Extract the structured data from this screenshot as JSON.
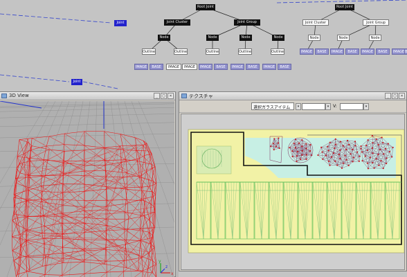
{
  "node_graph": {
    "nodes": [
      {
        "id": "n_left_sel",
        "label": "Joint",
        "style": "sel"
      },
      {
        "id": "n_root1",
        "label": "Root Joint",
        "style": "black"
      },
      {
        "id": "n_root2",
        "label": "Root Joint",
        "style": "black"
      },
      {
        "id": "n_a1",
        "label": "Joint Cluster",
        "style": "black"
      },
      {
        "id": "n_a2",
        "label": "Joint Group",
        "style": "black"
      },
      {
        "id": "n_b1",
        "label": "Joint Cluster",
        "style": "white"
      },
      {
        "id": "n_b2",
        "label": "Joint Group",
        "style": "white"
      },
      {
        "id": "n_c1",
        "label": "Node",
        "style": "black"
      },
      {
        "id": "n_c2",
        "label": "Node",
        "style": "black"
      },
      {
        "id": "n_c3",
        "label": "Node",
        "style": "black"
      },
      {
        "id": "n_c4",
        "label": "Node",
        "style": "black"
      },
      {
        "id": "n_d1",
        "label": "Node",
        "style": "white"
      },
      {
        "id": "n_d2",
        "label": "Node",
        "style": "white"
      },
      {
        "id": "n_d3",
        "label": "Node",
        "style": "white"
      },
      {
        "id": "n_e1",
        "label": "Outline",
        "style": "white"
      },
      {
        "id": "n_e2",
        "label": "Outline",
        "style": "white"
      },
      {
        "id": "n_e3",
        "label": "Outline",
        "style": "white"
      },
      {
        "id": "n_e4",
        "label": "Outline",
        "style": "white"
      },
      {
        "id": "n_e5",
        "label": "Outline",
        "style": "white"
      },
      {
        "id": "n_f1",
        "label": "IMAGE",
        "style": "blue"
      },
      {
        "id": "n_f2",
        "label": "BASE",
        "style": "blue"
      },
      {
        "id": "n_f3",
        "label": "IMAGE",
        "style": "white"
      },
      {
        "id": "n_f4",
        "label": "IMAGE",
        "style": "white"
      },
      {
        "id": "n_f5",
        "label": "IMAGE",
        "style": "blue"
      },
      {
        "id": "n_f6",
        "label": "BASE",
        "style": "blue"
      },
      {
        "id": "n_f7",
        "label": "IMAGE",
        "style": "blue"
      },
      {
        "id": "n_f8",
        "label": "BASE",
        "style": "blue"
      },
      {
        "id": "n_f9",
        "label": "IMAGE",
        "style": "blue"
      },
      {
        "id": "n_f10",
        "label": "BASE",
        "style": "blue"
      },
      {
        "id": "n_g1",
        "label": "IMAGE",
        "style": "blue"
      },
      {
        "id": "n_g2",
        "label": "BASE",
        "style": "blue"
      },
      {
        "id": "n_g3",
        "label": "IMAGE",
        "style": "blue"
      },
      {
        "id": "n_g4",
        "label": "BASE",
        "style": "blue"
      },
      {
        "id": "n_g5",
        "label": "IMAGE",
        "style": "blue"
      },
      {
        "id": "n_g6",
        "label": "BASE",
        "style": "blue"
      },
      {
        "id": "n_g7",
        "label": "IMAGE",
        "style": "blue"
      },
      {
        "id": "n_g8",
        "label": "BASE",
        "style": "blue"
      },
      {
        "id": "n_bottom_sel",
        "label": "Joint",
        "style": "sel"
      }
    ]
  },
  "viewport": {
    "title": "3D View",
    "buttons": [
      "min",
      "max",
      "close"
    ],
    "axis": {
      "x": "x",
      "y": "y",
      "z": "z"
    },
    "colors": {
      "mesh": "#ee1111",
      "grid": "#8c8c8c",
      "background": "#b0b0b0"
    }
  },
  "uv_editor": {
    "title": "テクスチャ",
    "buttons": [
      "min",
      "max",
      "close"
    ],
    "toolbar": {
      "select_label": "選択ガラスアイテム",
      "u_value": "",
      "v_label": "V:",
      "v_value": ""
    },
    "colors": {
      "yellow": "#f2f2a6",
      "cyan": "#bfeeee",
      "dark_outline": "#111111",
      "green_line": "#55bb55",
      "vertex": "#cc1111"
    }
  }
}
